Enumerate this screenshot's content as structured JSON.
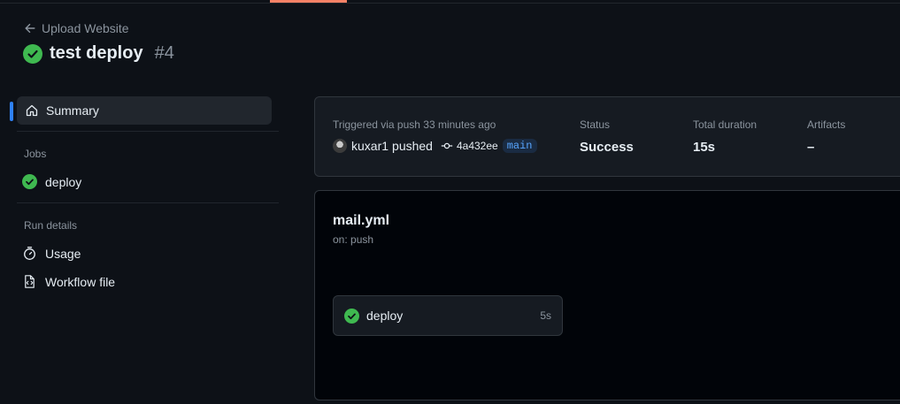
{
  "header": {
    "back_label": "Upload Website",
    "run_title": "test deploy",
    "run_number": "#4"
  },
  "sidebar": {
    "summary_label": "Summary",
    "jobs_heading": "Jobs",
    "jobs": [
      {
        "label": "deploy",
        "status": "success"
      }
    ],
    "run_details_heading": "Run details",
    "details": [
      {
        "label": "Usage",
        "icon": "stopwatch-icon"
      },
      {
        "label": "Workflow file",
        "icon": "file-code-icon"
      }
    ]
  },
  "summary": {
    "triggered_text": "Triggered via push 33 minutes ago",
    "actor": "kuxar1",
    "action": "pushed",
    "commit": "4a432ee",
    "branch": "main",
    "status_label": "Status",
    "status_value": "Success",
    "duration_label": "Total duration",
    "duration_value": "15s",
    "artifacts_label": "Artifacts",
    "artifacts_value": "–"
  },
  "workflow": {
    "file": "mail.yml",
    "trigger": "on: push",
    "job": {
      "name": "deploy",
      "duration": "5s",
      "status": "success"
    }
  },
  "colors": {
    "background": "#0d1117",
    "success": "#3fb950",
    "accent": "#2f81f7",
    "tab_underline": "#f78166"
  }
}
